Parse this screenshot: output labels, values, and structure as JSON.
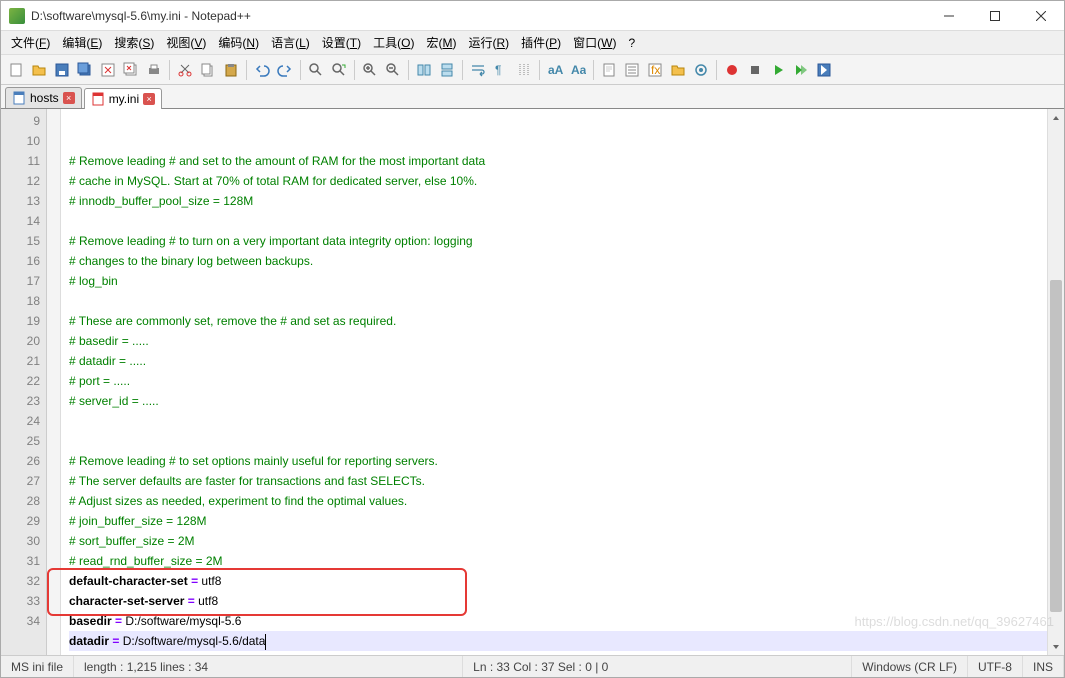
{
  "window": {
    "title": "D:\\software\\mysql-5.6\\my.ini - Notepad++"
  },
  "menu": {
    "file": {
      "label": "文件",
      "key": "F"
    },
    "edit": {
      "label": "编辑",
      "key": "E"
    },
    "search": {
      "label": "搜索",
      "key": "S"
    },
    "view": {
      "label": "视图",
      "key": "V"
    },
    "encoding": {
      "label": "编码",
      "key": "N"
    },
    "language": {
      "label": "语言",
      "key": "L"
    },
    "settings": {
      "label": "设置",
      "key": "T"
    },
    "tools": {
      "label": "工具",
      "key": "O"
    },
    "macro": {
      "label": "宏",
      "key": "M"
    },
    "run": {
      "label": "运行",
      "key": "R"
    },
    "plugins": {
      "label": "插件",
      "key": "P"
    },
    "window2": {
      "label": "窗口",
      "key": "W"
    },
    "help": {
      "label": "?",
      "key": ""
    }
  },
  "tabs": [
    {
      "name": "hosts",
      "active": false
    },
    {
      "name": "my.ini",
      "active": true
    }
  ],
  "code": {
    "startLine": 9,
    "lines": [
      {
        "n": 9,
        "t": "comment",
        "text": "# Remove leading # and set to the amount of RAM for the most important data"
      },
      {
        "n": 10,
        "t": "comment",
        "text": "# cache in MySQL. Start at 70% of total RAM for dedicated server, else 10%."
      },
      {
        "n": 11,
        "t": "comment",
        "text": "# innodb_buffer_pool_size = 128M"
      },
      {
        "n": 12,
        "t": "blank",
        "text": ""
      },
      {
        "n": 13,
        "t": "comment",
        "text": "# Remove leading # to turn on a very important data integrity option: logging"
      },
      {
        "n": 14,
        "t": "comment",
        "text": "# changes to the binary log between backups."
      },
      {
        "n": 15,
        "t": "comment",
        "text": "# log_bin"
      },
      {
        "n": 16,
        "t": "blank",
        "text": ""
      },
      {
        "n": 17,
        "t": "comment",
        "text": "# These are commonly set, remove the # and set as required."
      },
      {
        "n": 18,
        "t": "comment",
        "text": "# basedir = ....."
      },
      {
        "n": 19,
        "t": "comment",
        "text": "# datadir = ....."
      },
      {
        "n": 20,
        "t": "comment",
        "text": "# port = ....."
      },
      {
        "n": 21,
        "t": "comment",
        "text": "# server_id = ....."
      },
      {
        "n": 22,
        "t": "blank",
        "text": ""
      },
      {
        "n": 23,
        "t": "blank",
        "text": ""
      },
      {
        "n": 24,
        "t": "comment",
        "text": "# Remove leading # to set options mainly useful for reporting servers."
      },
      {
        "n": 25,
        "t": "comment",
        "text": "# The server defaults are faster for transactions and fast SELECTs."
      },
      {
        "n": 26,
        "t": "comment",
        "text": "# Adjust sizes as needed, experiment to find the optimal values."
      },
      {
        "n": 27,
        "t": "comment",
        "text": "# join_buffer_size = 128M"
      },
      {
        "n": 28,
        "t": "comment",
        "text": "# sort_buffer_size = 2M"
      },
      {
        "n": 29,
        "t": "comment",
        "text": "# read_rnd_buffer_size = 2M"
      },
      {
        "n": 30,
        "t": "kv",
        "key": "default-character-set",
        "val": "utf8"
      },
      {
        "n": 31,
        "t": "kv",
        "key": "character-set-server",
        "val": "utf8"
      },
      {
        "n": 32,
        "t": "kv",
        "key": "basedir",
        "val": "D:/software/mysql-5.6"
      },
      {
        "n": 33,
        "t": "kv",
        "key": "datadir",
        "val": "D:/software/mysql-5.6/data",
        "current": true
      },
      {
        "n": 34,
        "t": "blank",
        "text": ""
      }
    ]
  },
  "status": {
    "filetype": "MS ini file",
    "length": "length : 1,215    lines : 34",
    "pos": "Ln : 33    Col : 37    Sel : 0 | 0",
    "eol": "Windows (CR LF)",
    "enc": "UTF-8",
    "ovr": "INS"
  },
  "watermark": "https://blog.csdn.net/qq_39627461"
}
